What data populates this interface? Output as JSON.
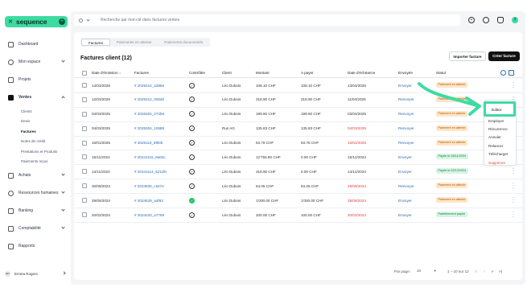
{
  "brand": {
    "name": "sequence",
    "add": "+"
  },
  "search": {
    "placeholder": "Recherche par mot-clé dans factures ventes"
  },
  "nav": {
    "dashboard": "Dashboard",
    "mon_espace": "Mon espace",
    "projets": "Projets",
    "ventes": "Ventes",
    "ventes_sub": [
      "Clients",
      "Devis",
      "Factures",
      "Notes de crédit",
      "Prestations et Produits",
      "Paiements reçus"
    ],
    "achats": "Achats",
    "rh": "Ressources humaines",
    "banking": "Banking",
    "compta": "Comptabilité",
    "rapports": "Rapports"
  },
  "user": {
    "initials": "ER",
    "name": "Emma Rogers"
  },
  "tabs": [
    "Factures",
    "Paiements en attente",
    "Paiements documentés"
  ],
  "title": "Factures client (12)",
  "buttons": {
    "import": "Importer facture",
    "create": "Créer facture"
  },
  "headers": {
    "date": "Date d'émission",
    "date_sort": "↓",
    "factures": "Factures",
    "controlee": "Contrôlée",
    "client": "Client",
    "montant": "Montant",
    "apayer": "A payer",
    "echeance": "Date d'échéance",
    "envoyee": "Envoyée",
    "statut": "Statut"
  },
  "rows": [
    {
      "date": "14/03/2025",
      "facture": "# 2025314_a3855",
      "client": "Léo Dubois",
      "montant": "108.10 CHF",
      "apayer": "108.10 CHF",
      "echeance": "13/04/2025",
      "echeance_red": false,
      "envoi": "Envoyer",
      "statut": "Paiement en attente",
      "kind": "orange",
      "check": "outline"
    },
    {
      "date": "12/03/2025",
      "facture": "# 2025312_005d0",
      "client": "Léo Dubois",
      "montant": "318.90 CHF",
      "apayer": "318.90 CHF",
      "echeance": "11/04/2025",
      "echeance_red": false,
      "envoi": "Renvoyer",
      "statut": "Paiement en attente",
      "kind": "orange",
      "check": "outline"
    },
    {
      "date": "04/03/2025",
      "facture": "# 2025304_272b8",
      "client": "Léo Dubois",
      "montant": "199.60 CHF",
      "apayer": "199.60 CHF",
      "echeance": "03/04/2025",
      "echeance_red": false,
      "envoi": "Renvoyer",
      "statut": "Paiement en attente",
      "kind": "orange",
      "check": "outline"
    },
    {
      "date": "04/03/2025",
      "facture": "# 2025304_10688",
      "client": "Rus AG",
      "montant": "135.83 CHF",
      "apayer": "135.83 CHF",
      "echeance": "04/03/2025",
      "echeance_red": true,
      "envoi": "Renvoyer",
      "statut": "Paiement en attente",
      "kind": "orange",
      "check": "outline"
    },
    {
      "date": "16/01/2025",
      "facture": "# 2025116_89feb",
      "client": "Léo Dubois",
      "montant": "63.78 CHF",
      "apayer": "63.78 CHF",
      "echeance": "15/02/2025",
      "echeance_red": true,
      "envoi": "Renvoyer",
      "statut": "Paiement en attente",
      "kind": "orange",
      "check": "outline"
    },
    {
      "date": "15/11/2024",
      "facture": "# 20241115_8a63c",
      "client": "Léo Dubois",
      "montant": "12'755.80 CHF",
      "apayer": "0.00 CHF",
      "echeance": "15/12/2024",
      "echeance_red": false,
      "envoi": "Envoyer",
      "statut": "Payée le 28/11/2024",
      "kind": "green",
      "check": "outline"
    },
    {
      "date": "14/11/2024",
      "facture": "# 20241114_5211f0",
      "client": "Léo Dubois",
      "montant": "318.90 CHF",
      "apayer": "0.00 CHF",
      "echeance": "14/12/2024",
      "echeance_red": false,
      "envoi": "Envoyer",
      "statut": "Payée le 02/12/2024",
      "kind": "green",
      "check": "outline"
    },
    {
      "date": "30/08/2024",
      "facture": "# 2024830_c647e",
      "client": "Léo Dubois",
      "montant": "54.05 CHF",
      "apayer": "54.05 CHF",
      "echeance": "29/09/2024",
      "echeance_red": true,
      "envoi": "Renvoyer",
      "statut": "Paiement en attente",
      "kind": "orange",
      "check": "outline"
    },
    {
      "date": "29/05/2024",
      "facture": "# 2024529_a4f93",
      "client": "Léo Dubois",
      "montant": "1'000.00 CHF",
      "apayer": "1'000.00 CHF",
      "echeance": "28/06/2024",
      "echeance_red": true,
      "envoi": "Envoyer",
      "statut": "Paiement en attente",
      "kind": "orange",
      "check": "green"
    },
    {
      "date": "20/02/2024",
      "facture": "# 2024220_a7759",
      "client": "Léo Dubois",
      "montant": "200.00 CHF",
      "apayer": "100.00 CHF",
      "echeance": "20/02/2024",
      "echeance_red": true,
      "envoi": "Envoyer",
      "statut": "Partiellement payée",
      "kind": "green",
      "check": "outline"
    }
  ],
  "menu": {
    "items": [
      "Editer",
      "Employer",
      "Récurrence",
      "Annuler",
      "Relancer",
      "Télécharger",
      "Supprimer"
    ]
  },
  "pager": {
    "label": "Par page:",
    "per_page": "10",
    "range": "1 – 10 sur 12",
    "first": "|<",
    "prev": "<",
    "next": ">",
    "last": ">|"
  },
  "colors": {
    "accent": "#3ddba2",
    "link": "#2b6cb0",
    "danger": "#e53e3e"
  }
}
